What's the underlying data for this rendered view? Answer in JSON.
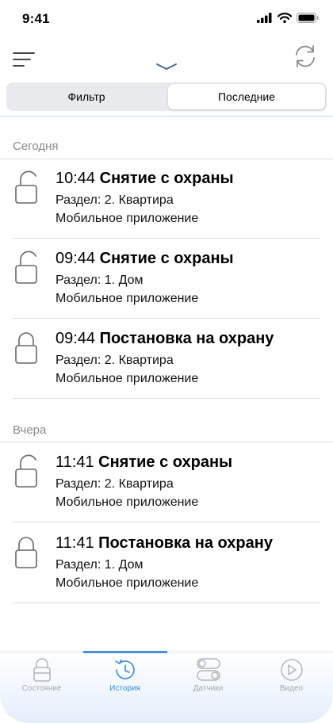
{
  "status_bar": {
    "time": "9:41"
  },
  "segmented": {
    "filter_label": "Фильтр",
    "recent_label": "Последние"
  },
  "sections": [
    {
      "header": "Сегодня",
      "events": [
        {
          "time": "10:44",
          "action": "Снятие с охраны",
          "partition": "Раздел: 2. Квартира",
          "source": "Мобильное приложение",
          "locked": false
        },
        {
          "time": "09:44",
          "action": "Снятие с охраны",
          "partition": "Раздел: 1. Дом",
          "source": "Мобильное приложение",
          "locked": false
        },
        {
          "time": "09:44",
          "action": "Постановка на охрану",
          "partition": "Раздел: 2. Квартира",
          "source": "Мобильное приложение",
          "locked": true
        }
      ]
    },
    {
      "header": "Вчера",
      "events": [
        {
          "time": "11:41",
          "action": "Снятие с охраны",
          "partition": "Раздел: 2. Квартира",
          "source": "Мобильное приложение",
          "locked": false
        },
        {
          "time": "11:41",
          "action": "Постановка на охрану",
          "partition": "Раздел: 1. Дом",
          "source": "Мобильное приложение",
          "locked": true
        }
      ]
    }
  ],
  "tabbar": {
    "tabs": [
      {
        "label": "Состояние",
        "icon": "lock-status-icon",
        "active": false
      },
      {
        "label": "История",
        "icon": "history-clock-icon",
        "active": true
      },
      {
        "label": "Датчики",
        "icon": "sensors-toggle-icon",
        "active": false
      },
      {
        "label": "Видео",
        "icon": "video-play-icon",
        "active": false
      }
    ]
  },
  "colors": {
    "accent": "#3a8ad9",
    "inactive": "#a8a8a8",
    "divider": "#dedede"
  }
}
